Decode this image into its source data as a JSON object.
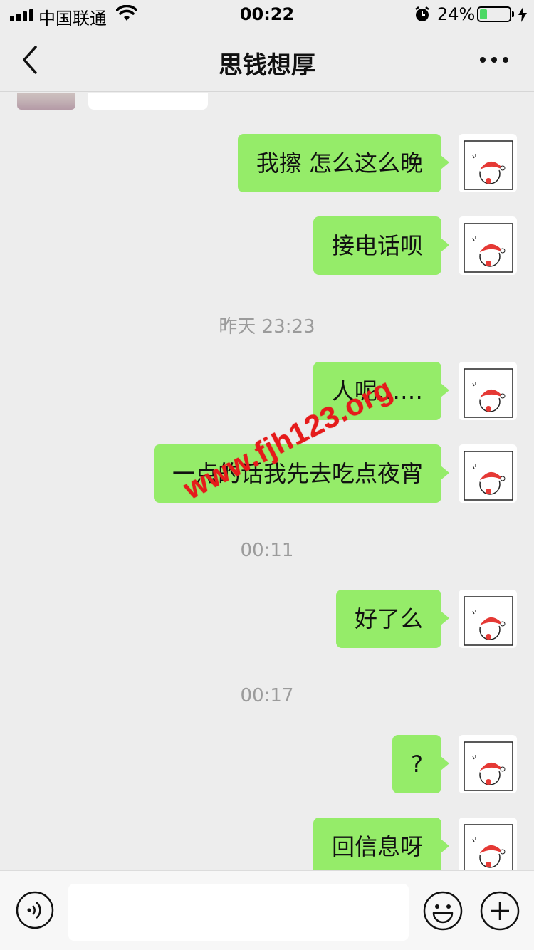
{
  "status_bar": {
    "carrier": "中国联通",
    "time": "00:22",
    "battery_percent": "24%",
    "battery_level": 0.24,
    "icons": [
      "signal-icon",
      "wifi-icon",
      "alarm-icon",
      "battery-icon",
      "charging-icon"
    ]
  },
  "nav": {
    "title": "思钱想厚",
    "back_icon": "chevron-left-icon",
    "more_icon": "more-dots-icon"
  },
  "messages": [
    {
      "type": "sent",
      "text": "我擦 怎么这么晚"
    },
    {
      "type": "sent",
      "text": "接电话呗"
    },
    {
      "type": "time",
      "text": "昨天 23:23"
    },
    {
      "type": "sent",
      "text": "人呢……"
    },
    {
      "type": "sent",
      "text": "一点的话我先去吃点夜宵"
    },
    {
      "type": "time",
      "text": "00:11"
    },
    {
      "type": "sent",
      "text": "好了么"
    },
    {
      "type": "time",
      "text": "00:17"
    },
    {
      "type": "sent",
      "text": "?"
    },
    {
      "type": "sent",
      "text": "回信息呀"
    }
  ],
  "watermark": "www.fjh123.org",
  "input_bar": {
    "voice_icon": "voice-icon",
    "emoji_icon": "emoji-icon",
    "plus_icon": "plus-icon",
    "placeholder": ""
  },
  "colors": {
    "background": "#ededed",
    "sent_bubble": "#95ec69",
    "timestamp": "#9b9b9b",
    "battery_fill": "#4cd964",
    "watermark": "#e51b1b"
  }
}
